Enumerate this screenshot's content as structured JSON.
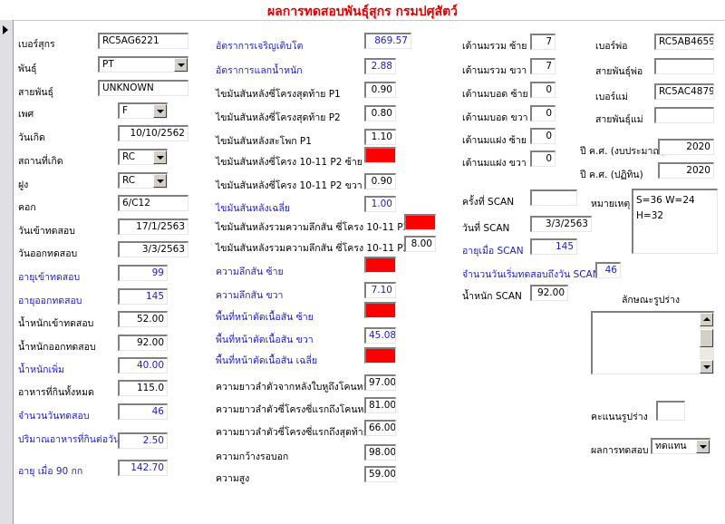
{
  "title": "ผลการทดสอบพันธุ์สุกร กรมปศุสัตว์",
  "left": {
    "pig_id": {
      "label": "เบอร์สุกร",
      "value": "RC5AG6221"
    },
    "breed": {
      "label": "พันธุ์",
      "value": "PT"
    },
    "strain": {
      "label": "สายพันธุ์",
      "value": "UNKNOWN"
    },
    "sex": {
      "label": "เพศ",
      "value": "F"
    },
    "birth_date": {
      "label": "วันเกิด",
      "value": "10/10/2562"
    },
    "birth_place": {
      "label": "สถานที่เกิด",
      "value": "RC"
    },
    "herd": {
      "label": "ฝูง",
      "value": "RC"
    },
    "pen": {
      "label": "คอก",
      "value": "6/C12"
    },
    "test_in_date": {
      "label": "วันเข้าทดสอบ",
      "value": "17/1/2563"
    },
    "test_out_date": {
      "label": "วันออกทดสอบ",
      "value": "3/3/2563"
    },
    "age_in": {
      "label": "อายุเข้าทดสอบ",
      "value": "99"
    },
    "age_out": {
      "label": "อายุออกทดสอบ",
      "value": "145"
    },
    "weight_in": {
      "label": "น้ำหนักเข้าทดสอบ",
      "value": "52.00"
    },
    "weight_out": {
      "label": "น้ำหนักออกทดสอบ",
      "value": "92.00"
    },
    "weight_gain": {
      "label": "น้ำหนักเพิ่ม",
      "value": "40.00"
    },
    "feed_total": {
      "label": "อาหารที่กินทั้งหมด",
      "value": "115.0"
    },
    "test_days": {
      "label": "จำนวนวันทดสอบ",
      "value": "46"
    },
    "feed_per_day": {
      "label": "ปริมาณอาหารที่กินต่อวัน",
      "value": "2.50"
    },
    "age_90kg": {
      "label": "อายุ เมื่อ 90 กก",
      "value": "142.70"
    }
  },
  "middle": {
    "adg": {
      "label": "อัตราการเจริญเติบโต",
      "value": "869.57"
    },
    "fcr": {
      "label": "อัตราการแลกน้ำหนัก",
      "value": "2.88"
    },
    "bf_last_rib_p1": {
      "label": "ไขมันสันหลังซี่โครงสุดท้าย P1",
      "value": "0.90"
    },
    "bf_last_rib_p2": {
      "label": "ไขมันสันหลังซี่โครงสุดท้าย P2",
      "value": "0.80"
    },
    "bf_hip_p1": {
      "label": "ไขมันสันหลังสะโพก P1",
      "value": "1.10"
    },
    "bf_rib1011_left": {
      "label": "ไขมันสันหลังซี่โครง 10-11 P2 ซ้าย",
      "value": ""
    },
    "bf_rib1011_right": {
      "label": "ไขมันสันหลังซี่โครง 10-11 P2 ขวา",
      "value": "0.90"
    },
    "bf_avg": {
      "label": "ไขมันสันหลังเฉลี่ย",
      "value": "1.00"
    },
    "bf_total_left": {
      "label": "ไขมันสันหลังรวมความลึกสัน ซี่โครง 10-11 P2 ซ้าย",
      "value": ""
    },
    "bf_total_right": {
      "label": "ไขมันสันหลังรวมความลึกสัน ซี่โครง 10-11 P2 ขวา",
      "value": "8.00"
    },
    "loin_depth_left": {
      "label": "ความลึกสัน ซ้าย",
      "value": ""
    },
    "loin_depth_right": {
      "label": "ความลึกสัน ขวา",
      "value": "7.10"
    },
    "loin_area_left": {
      "label": "พื้นที่หน้าตัดเนื้อสัน ซ้าย",
      "value": ""
    },
    "loin_area_right": {
      "label": "พื้นที่หน้าตัดเนื้อสัน ขวา",
      "value": "45.08"
    },
    "loin_area_avg": {
      "label": "พื้นที่หน้าตัดเนื้อสัน เฉลี่ย",
      "value": ""
    },
    "body_length_tail": {
      "label": "ความยาวลำตัวจากหลังใบหูถึงโคนหาง",
      "value": "97.00"
    },
    "body_length_rib_tail": {
      "label": "ความยาวลำตัวซี่โครงซี่แรกถึงโคนหาง",
      "value": "81.00"
    },
    "body_length_rib_last": {
      "label": "ความยาวลำตัวซี่โครงซี่แรกถึงสุดท้าย",
      "value": "66.00"
    },
    "chest_girth": {
      "label": "ความกว้างรอบอก",
      "value": "98.00"
    },
    "height": {
      "label": "ความสูง",
      "value": "59.00"
    }
  },
  "teats": {
    "total_left": {
      "label": "เต้านมรวม ซ้าย",
      "value": "7"
    },
    "total_right": {
      "label": "เต้านมรวม ขวา",
      "value": "7"
    },
    "blind_left": {
      "label": "เต้านมบอด ซ้าย",
      "value": "0"
    },
    "blind_right": {
      "label": "เต้านมบอด ขวา",
      "value": "0"
    },
    "inverted_left": {
      "label": "เต้านมแฝง ซ้าย",
      "value": "0"
    },
    "inverted_right": {
      "label": "เต้านมแฝง ขวา",
      "value": "0"
    }
  },
  "scan": {
    "scan_no": {
      "label": "ครั้งที่ SCAN",
      "value": ""
    },
    "scan_date": {
      "label": "วันที่ SCAN",
      "value": "3/3/2563"
    },
    "scan_age": {
      "label": "อายุเมื่อ SCAN",
      "value": "145"
    },
    "days_to_scan": {
      "label": "จำนวนวันเริ่มทดสอบถึงวัน SCAN",
      "value": "46"
    },
    "scan_weight": {
      "label": "น้ำหนัก SCAN",
      "value": "92.00"
    }
  },
  "right": {
    "sire_id": {
      "label": "เบอร์พ่อ",
      "value": "RC5AB4659"
    },
    "sire_strain": {
      "label": "สายพันธุ์พ่อ",
      "value": ""
    },
    "dam_id": {
      "label": "เบอร์แม่",
      "value": "RC5AC4879"
    },
    "dam_strain": {
      "label": "สายพันธุ์แม่",
      "value": ""
    },
    "budget_year": {
      "label": "ปี ค.ศ. (งบประมาณ)",
      "value": "2020"
    },
    "calendar_year": {
      "label": "ปี ค.ศ. (ปฏิทิน)",
      "value": "2020"
    },
    "remark_label": "หมายเหตุ",
    "remark_lines": [
      "S=36 W=24",
      "H=32"
    ],
    "conformation_label": "ลักษณะรูปร่าง",
    "conformation_score": {
      "label": "คะแนนรูปร่าง",
      "value": ""
    },
    "test_result": {
      "label": "ผลการทดสอบ",
      "value": "ทดแทน"
    }
  }
}
